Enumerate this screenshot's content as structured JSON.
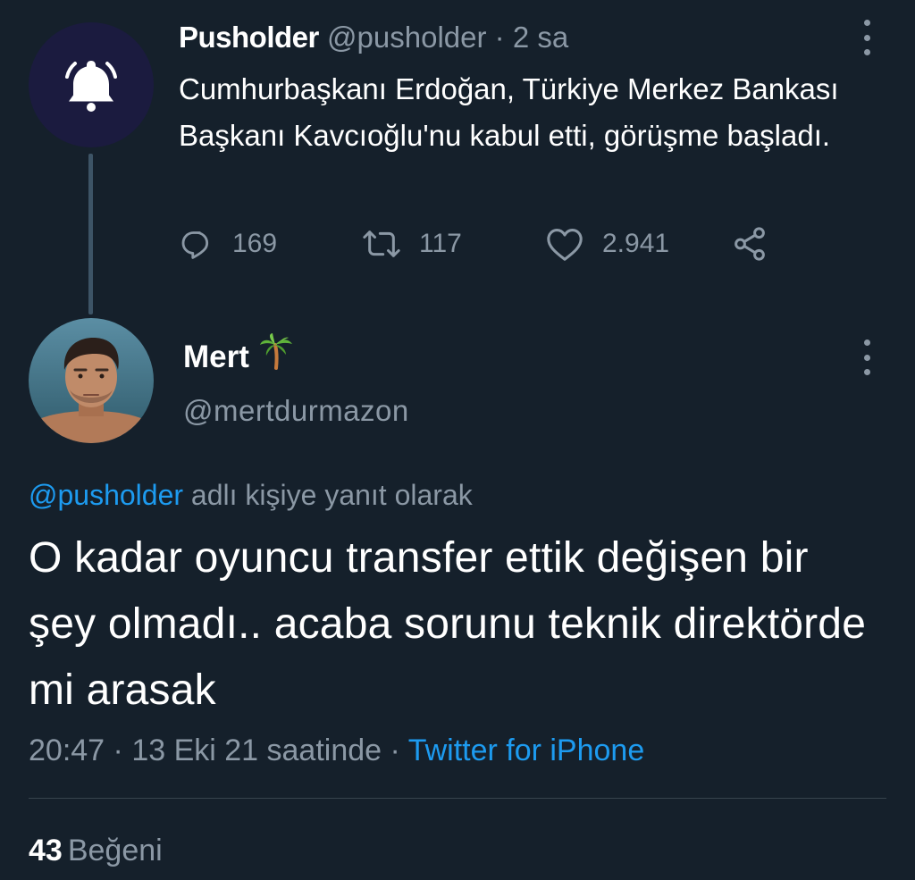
{
  "parent_tweet": {
    "author_name": "Pusholder",
    "author_handle": "@pusholder",
    "separator": " · ",
    "time_ago": "2 sa",
    "avatar_icon": "bell-icon",
    "text": "Cumhurbaşkanı Erdoğan, Türkiye Merkez Bankası Başkanı Kavcıoğlu'nu kabul etti, görüşme başladı.",
    "stats": {
      "replies": "169",
      "retweets": "117",
      "likes": "2.941"
    }
  },
  "reply_tweet": {
    "author_name": "Mert",
    "author_emoji": "palm-tree-icon",
    "author_handle": "@mertdurmazon",
    "replying_to_handle": "@pusholder",
    "replying_to_suffix": " adlı kişiye yanıt olarak",
    "text": "O kadar oyuncu transfer ettik değişen bir şey olmadı.. acaba sorunu teknik direktörde mi arasak",
    "time": "20:47",
    "date_text": "13 Eki 21 saatinde",
    "separator": " · ",
    "source": "Twitter for iPhone",
    "like_count": "43",
    "like_label": "Beğeni"
  },
  "colors": {
    "background": "#15202b",
    "text_primary": "#ffffff",
    "text_muted": "#8b98a5",
    "accent": "#1d9bf0",
    "divider": "#38444d"
  }
}
